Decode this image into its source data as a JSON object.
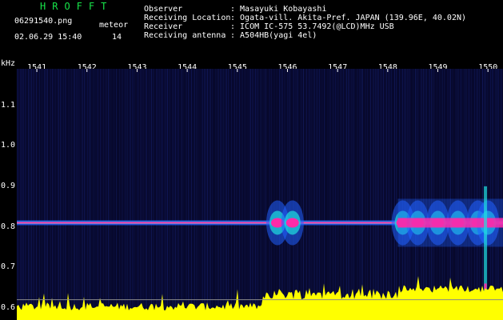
{
  "header": {
    "app_title": "HROFFT",
    "filename": "06291540.png",
    "datetime": "02.06.29 15:40",
    "meteor_label": "meteor",
    "meteor_count": "14"
  },
  "info": {
    "observer_label": "Observer",
    "observer_value": ": Masayuki Kobayashi",
    "location_label": "Receiving Location",
    "location_value": ": Ogata-vill. Akita-Pref. JAPAN (139.96E, 40.02N)",
    "receiver_label": "Receiver",
    "receiver_value": ": ICOM IC-575 53.7492(@LCD)MHz USB",
    "antenna_label": "Receiving antenna",
    "antenna_value": ": A504HB(yagi 4el)"
  },
  "chart_data": {
    "type": "heatmap",
    "freq_unit": "kHz",
    "time_ticks": [
      "1541",
      "1542",
      "1543",
      "1544",
      "1545",
      "1546",
      "1547",
      "1548",
      "1549",
      "1550"
    ],
    "freq_ticks": [
      "1.1",
      "1.0",
      "0.9",
      "0.8",
      "0.7",
      "0.6"
    ],
    "freq_tick_values": [
      1.1,
      1.0,
      0.9,
      0.8,
      0.7,
      0.6
    ],
    "ylim": [
      0.57,
      1.19
    ],
    "carrier_freq": 0.81,
    "signal_bursts_time": [
      1545.8,
      1546.1,
      1548.3,
      1548.6,
      1549.0,
      1549.4,
      1549.8,
      1550.0
    ],
    "colors": {
      "background": "#060626",
      "noise": "#1a2a8a",
      "signal_high": "#ff2aa8",
      "signal_mid": "#20e0e0",
      "signal_low": "#2060ff",
      "power_trace": "#ffff00",
      "axis_text": "#ffffff",
      "title": "#17e64a"
    }
  }
}
